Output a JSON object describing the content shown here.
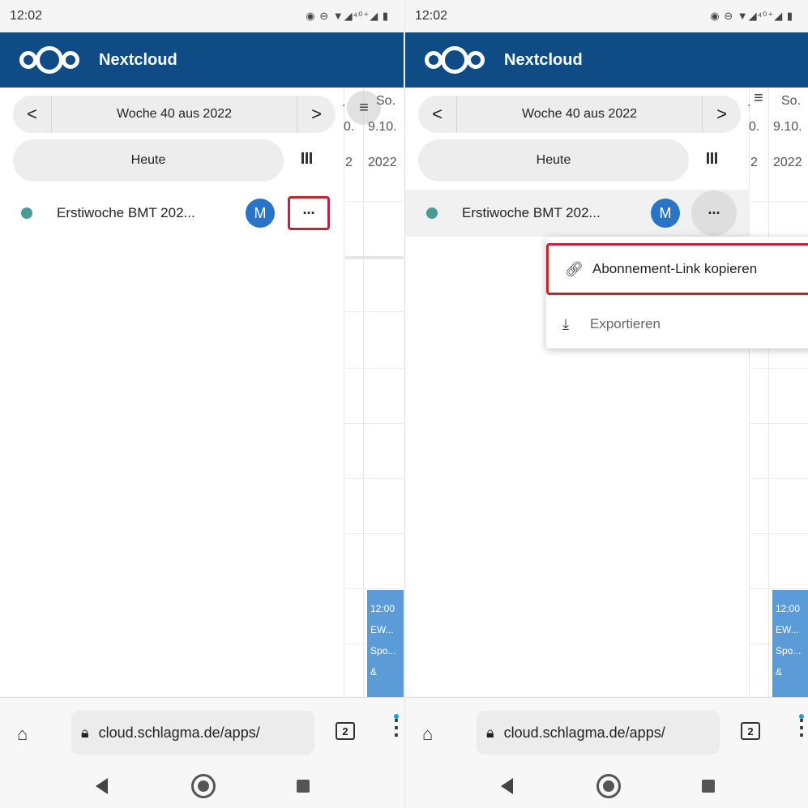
{
  "status": {
    "time": "12:02",
    "icons": "◉ ⊖ ▼◢⁴⁰⁺◢ ▮"
  },
  "app": {
    "title": "Nextcloud"
  },
  "week_nav": {
    "prev": "<",
    "label": "Woche 40 aus 2022",
    "next": ">"
  },
  "today_label": "Heute",
  "calendar": {
    "name": "Erstiwoche BMT 202...",
    "avatar": "M",
    "more": "···"
  },
  "day_column": {
    "day_lines": [
      "So.",
      "9.10.",
      "2022"
    ],
    "prev_lines": [
      ".",
      "0.",
      "2"
    ]
  },
  "event": {
    "lines": [
      "12:00",
      "EW...",
      "Spo...",
      "&"
    ]
  },
  "menu": [
    {
      "icon": "link-icon",
      "label": "Abonnement-Link kopieren"
    },
    {
      "icon": "download-icon",
      "label": "Exportieren"
    }
  ],
  "browser": {
    "url": "cloud.schlagma.de/apps/",
    "tab_count": "2"
  },
  "colors": {
    "header": "#0f4c85",
    "calendar_dot": "#4a9b98",
    "avatar": "#2a74c8",
    "highlight_border": "#c62033",
    "event": "#5a9bd8"
  }
}
